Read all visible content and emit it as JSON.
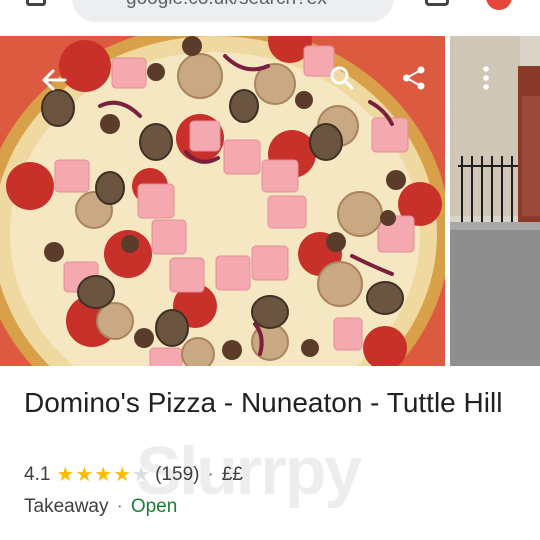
{
  "browser": {
    "url_text": "google.co.uk/search?ex",
    "icons": [
      "home-icon",
      "tabs-icon",
      "avatar"
    ]
  },
  "media": {
    "controls": [
      "back-arrow-icon",
      "search-icon",
      "share-icon",
      "more-vert-icon"
    ],
    "accent_color": "#ffffff"
  },
  "place": {
    "title": "Domino's Pizza - Nuneaton - Tuttle Hill",
    "rating": "4.1",
    "stars": 4.1,
    "reviews": "(159)",
    "separator": "·",
    "price": "££",
    "category": "Takeaway",
    "status": "Open",
    "status_color": "#188038",
    "star_color": "#fbbc04"
  },
  "watermark": {
    "text": "Slurrpy"
  }
}
